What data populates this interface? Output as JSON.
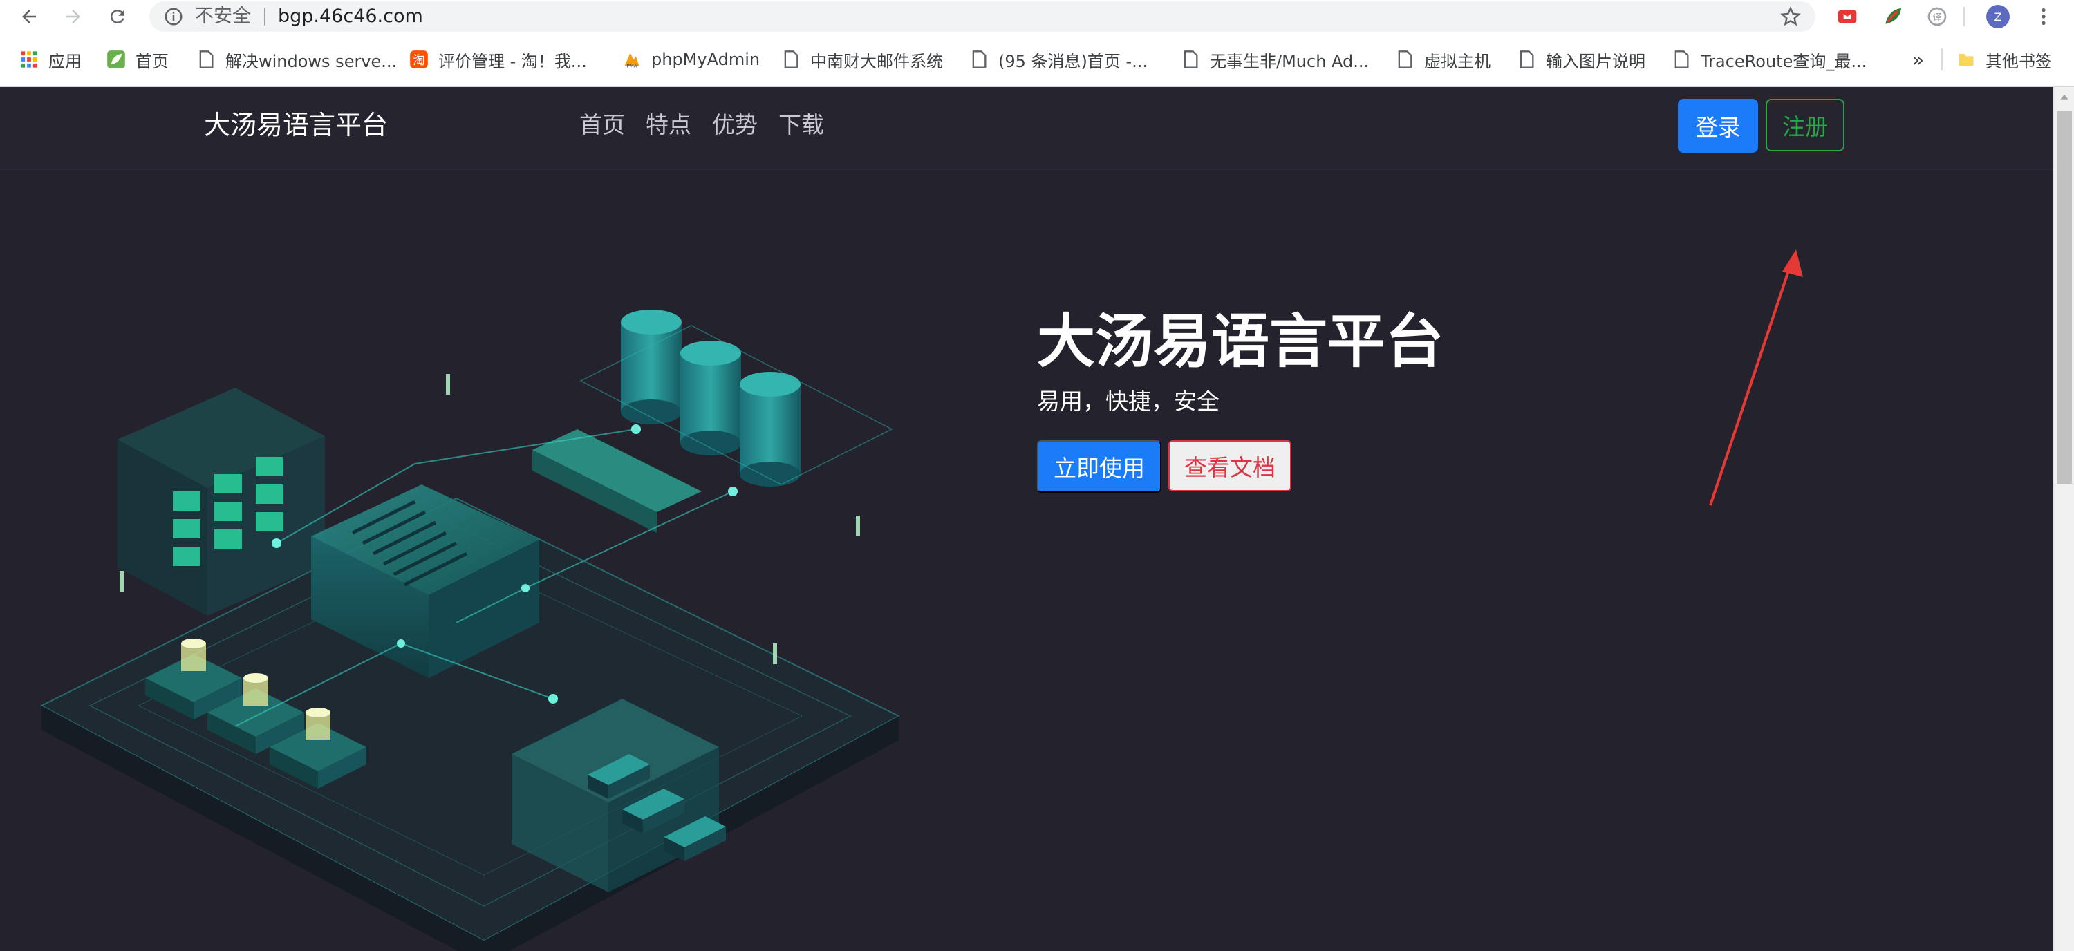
{
  "browser": {
    "security_label": "不安全",
    "url": "bgp.46c46.com",
    "profile_initial": "Z",
    "bookmarks": [
      {
        "label": "应用",
        "icon": "apps-grid-icon"
      },
      {
        "label": "首页",
        "icon": "leaf-icon"
      },
      {
        "label": "解决windows serve...",
        "icon": "page-icon"
      },
      {
        "label": "评价管理 - 淘！我...",
        "icon": "taobao-icon"
      },
      {
        "label": "phpMyAdmin",
        "icon": "phpmyadmin-icon"
      },
      {
        "label": "中南财大邮件系统",
        "icon": "page-icon"
      },
      {
        "label": "(95 条消息)首页 -...",
        "icon": "page-icon"
      },
      {
        "label": "无事生非/Much Ad...",
        "icon": "page-icon"
      },
      {
        "label": "虚拟主机",
        "icon": "page-icon"
      },
      {
        "label": "输入图片说明",
        "icon": "page-icon"
      },
      {
        "label": "TraceRoute查询_最...",
        "icon": "page-icon"
      }
    ],
    "overflow_label": "»",
    "other_bookmarks_label": "其他书签"
  },
  "site": {
    "brand": "大汤易语言平台",
    "nav": [
      "首页",
      "特点",
      "优势",
      "下载"
    ],
    "login_label": "登录",
    "register_label": "注册"
  },
  "hero": {
    "title": "大汤易语言平台",
    "subtitle": "易用，快捷，安全",
    "primary_button": "立即使用",
    "secondary_button": "查看文档"
  },
  "colors": {
    "page_bg": "#23222d",
    "primary": "#1a7cf8",
    "success": "#28a745",
    "danger": "#dc3545",
    "annotation": "#e53935",
    "illustration_teal": "#1fa39a"
  }
}
